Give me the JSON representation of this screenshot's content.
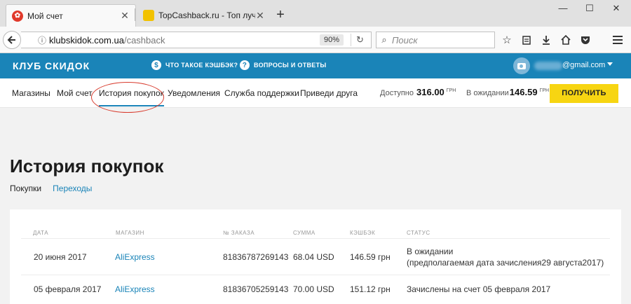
{
  "browser": {
    "tabs": [
      {
        "title": "Мой счет",
        "active": true
      },
      {
        "title": "TopCashback.ru - Топ лучш",
        "active": false
      }
    ],
    "url_host": "klubskidok.com.ua",
    "url_path": "/cashback",
    "zoom": "90%",
    "search_placeholder": "Поиск"
  },
  "site": {
    "logo": "КЛУБ СКИДОК",
    "header_links": [
      {
        "label": "ЧТО ТАКОЕ КЭШБЭК?",
        "icon": "dollar-icon"
      },
      {
        "label": "ВОПРОСЫ И ОТВЕТЫ",
        "icon": "question-icon"
      }
    ],
    "email": "@gmail.com"
  },
  "subnav": {
    "items": [
      "Магазины",
      "Мой счет",
      "История покупок",
      "Уведомления",
      "Служба поддержки",
      "Приведи друга"
    ],
    "active_index": 2,
    "available_label": "Доступно",
    "available_value": "316.00",
    "pending_label": "В ожидании",
    "pending_value": "146.59",
    "currency": "ГРН",
    "get_button": "ПОЛУЧИТЬ"
  },
  "page": {
    "title": "История покупок",
    "subtabs": [
      "Покупки",
      "Переходы"
    ]
  },
  "table": {
    "columns": [
      "ДАТА",
      "МАГАЗИН",
      "№ ЗАКАЗА",
      "СУММА",
      "КЭШБЭК",
      "СТАТУС"
    ],
    "rows": [
      {
        "date": "20 июня 2017",
        "store": "AliExpress",
        "order": "81836787269143",
        "amount": "68.04 USD",
        "cashback": "146.59 грн",
        "status": "В ожидании",
        "status_note": "(предполагаемая дата зачисления29 августа2017)"
      },
      {
        "date": "05 февраля 2017",
        "store": "AliExpress",
        "order": "81836705259143",
        "amount": "70.00 USD",
        "cashback": "151.12 грн",
        "status": "Зачислены на счет 05 февраля 2017",
        "status_note": ""
      }
    ]
  },
  "colors": {
    "brand_blue": "#1a84b8",
    "button_yellow": "#f7d512",
    "annotation_red": "#d83a2c"
  }
}
